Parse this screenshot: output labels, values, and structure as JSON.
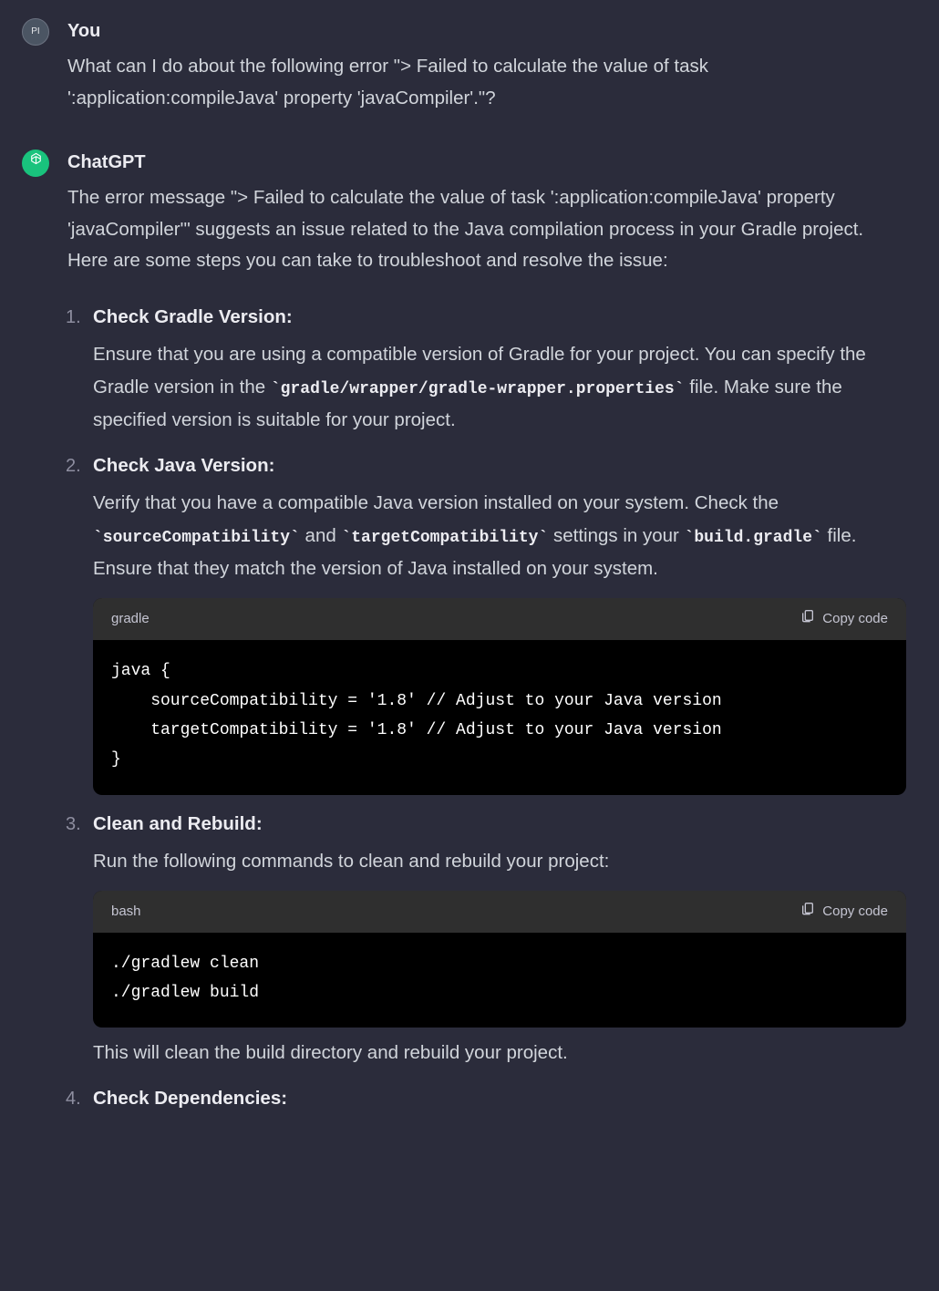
{
  "messages": {
    "user": {
      "avatar_text": "PI",
      "sender": "You",
      "text": "What can I do about the following error \"> Failed to calculate the value of task ':application:compileJava' property 'javaCompiler'.\"?"
    },
    "assistant": {
      "sender": "ChatGPT",
      "intro": "The error message \"> Failed to calculate the value of task ':application:compileJava' property 'javaCompiler'\" suggests an issue related to the Java compilation process in your Gradle project. Here are some steps you can take to troubleshoot and resolve the issue:",
      "steps": [
        {
          "title": "Check Gradle Version:",
          "desc_before": "Ensure that you are using a compatible version of Gradle for your project. You can specify the Gradle version in the ",
          "code1": "`gradle/wrapper/gradle-wrapper.properties`",
          "desc_after": " file. Make sure the specified version is suitable for your project."
        },
        {
          "title": "Check Java Version:",
          "desc_before": "Verify that you have a compatible Java version installed on your system. Check the ",
          "code1": "`sourceCompatibility`",
          "mid1": " and ",
          "code2": "`targetCompatibility`",
          "mid2": " settings in your ",
          "code3": "`build.gradle`",
          "desc_after": " file. Ensure that they match the version of Java installed on your system.",
          "codeblock": {
            "lang": "gradle",
            "copy": "Copy code",
            "content": "java {\n    sourceCompatibility = '1.8' // Adjust to your Java version\n    targetCompatibility = '1.8' // Adjust to your Java version\n}"
          }
        },
        {
          "title": "Clean and Rebuild:",
          "desc_before": "Run the following commands to clean and rebuild your project:",
          "codeblock": {
            "lang": "bash",
            "copy": "Copy code",
            "content": "./gradlew clean\n./gradlew build"
          },
          "desc_after2": "This will clean the build directory and rebuild your project."
        },
        {
          "title": "Check Dependencies:"
        }
      ]
    }
  }
}
